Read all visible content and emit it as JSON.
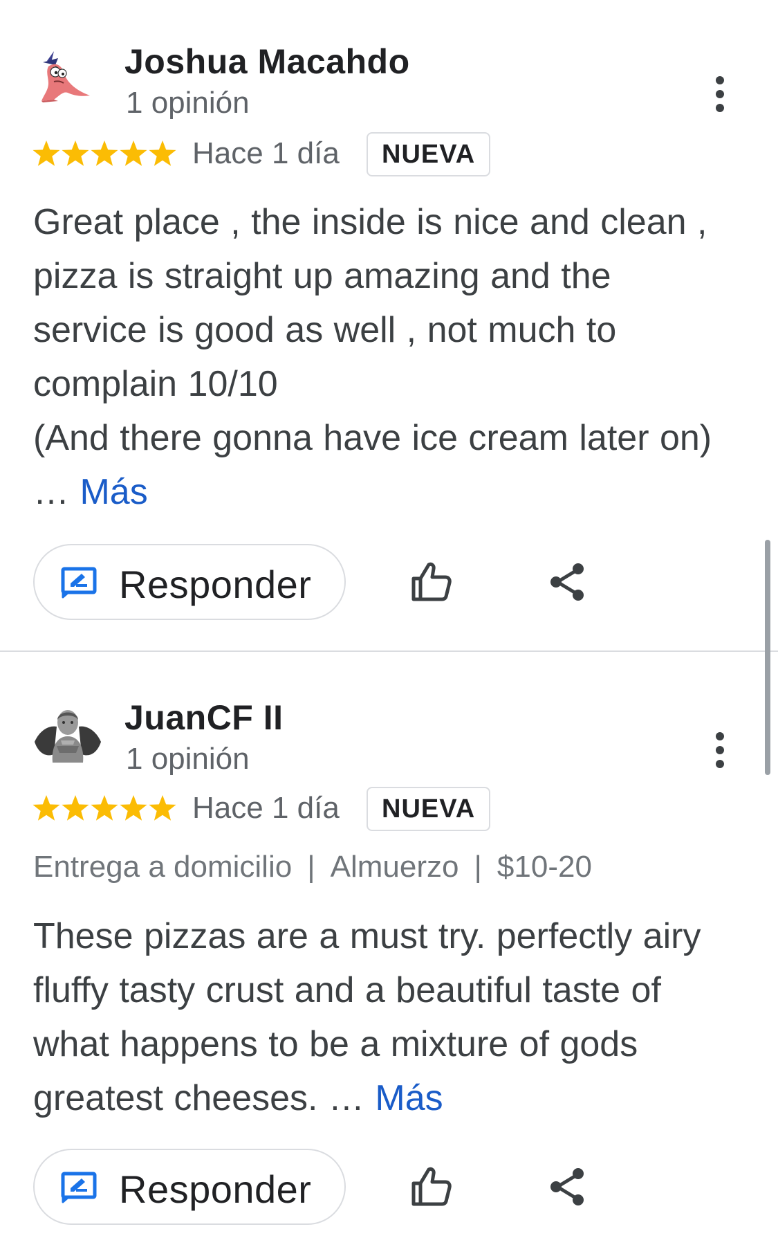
{
  "reviews": [
    {
      "author": "Joshua Macahdo",
      "review_count": "1 opinión",
      "rating": 5,
      "time_ago": "Hace 1 día",
      "badge": "NUEVA",
      "text_lines": [
        "Great place , the inside is nice and clean ,",
        "pizza is straight up amazing and the",
        "service is good as well , not much to",
        "complain 10/10",
        "(And there gonna have ice cream later on)"
      ],
      "ellipsis": "…",
      "more_label": "Más",
      "reply_label": "Responder",
      "avatar_icon": "cartoon-starfish-avatar"
    },
    {
      "author": "JuanCF II",
      "review_count": "1 opinión",
      "rating": 5,
      "time_ago": "Hace 1 día",
      "badge": "NUEVA",
      "attributes": [
        "Entrega a domicilio",
        "Almuerzo",
        "$10-20"
      ],
      "attribute_separator": "|",
      "text_lines": [
        "These pizzas are a must try. perfectly airy",
        "fluffy tasty crust and a beautiful taste of",
        "what happens to be a mixture of gods"
      ],
      "last_line": "greatest cheeses.",
      "ellipsis": "…",
      "more_label": "Más",
      "reply_label": "Responder",
      "avatar_icon": "statue-photo-avatar"
    }
  ],
  "icons": {
    "star": "star-icon",
    "more": "more-vert-icon",
    "reply": "reply-edit-icon",
    "like": "thumbs-up-icon",
    "share": "share-icon"
  },
  "colors": {
    "star": "#fbbc04",
    "link": "#1a5cc8",
    "reply_icon": "#1a73e8",
    "text": "#3c4043",
    "secondary": "#5f6368",
    "border": "#dadce0"
  }
}
